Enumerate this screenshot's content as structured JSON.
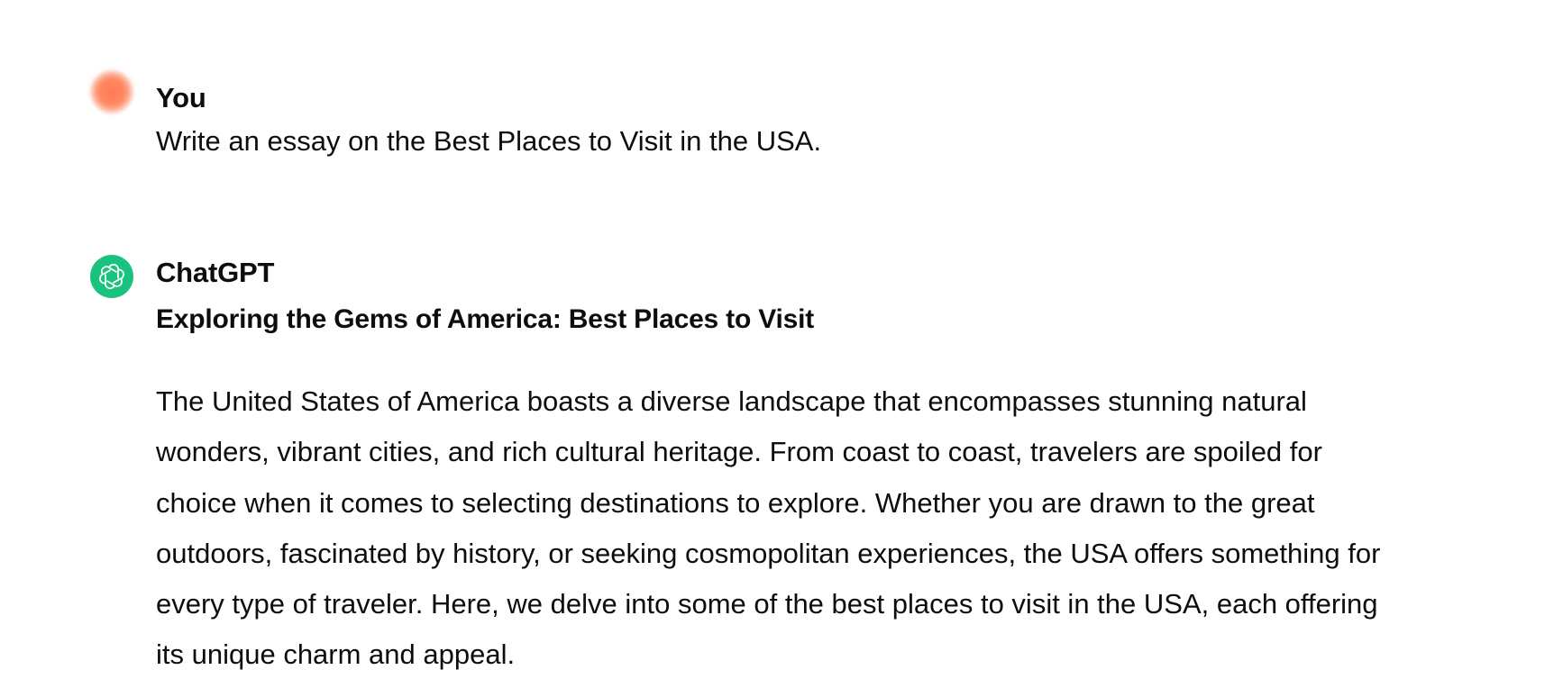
{
  "conversation": {
    "user": {
      "author": "You",
      "text": "Write an essay on the Best Places to Visit in the USA."
    },
    "assistant": {
      "author": "ChatGPT",
      "heading": "Exploring the Gems of America: Best Places to Visit",
      "paragraph": "The United States of America boasts a diverse landscape that encompasses stunning natural wonders, vibrant cities, and rich cultural heritage. From coast to coast, travelers are spoiled for choice when it comes to selecting destinations to explore. Whether you are drawn to the great outdoors, fascinated by history, or seeking cosmopolitan experiences, the USA offers something for every type of traveler. Here, we delve into some of the best places to visit in the USA, each offering its unique charm and appeal."
    }
  },
  "icons": {
    "user_avatar": "user-avatar-icon",
    "assistant_avatar": "openai-logo-icon"
  },
  "colors": {
    "user_avatar": "#ff7a52",
    "assistant_avatar": "#19c37d",
    "text": "#0d0d0d",
    "background": "#ffffff"
  }
}
